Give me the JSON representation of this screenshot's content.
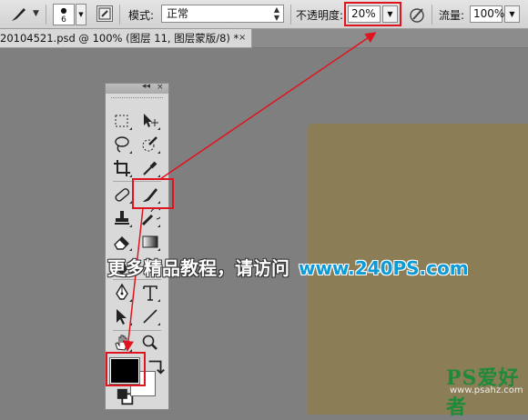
{
  "options_bar": {
    "brush_size": "6",
    "mode_label": "模式:",
    "mode_value": "正常",
    "opacity_label": "不透明度:",
    "opacity_value": "20%",
    "flow_label": "流量:",
    "flow_value": "100%"
  },
  "document_tab": {
    "title": "20104521.psd @ 100% (图层 11, 图层蒙版/8) *",
    "close": "×"
  },
  "tools_panel": {
    "collapse": "◂◂",
    "close": "×"
  },
  "colors": {
    "foreground": "#000000",
    "background": "#ffffff",
    "canvas": "#8b7d56",
    "highlight": "#e0141e"
  },
  "watermark": {
    "text": "更多精品教程，请访问",
    "url": "www.240PS.com"
  },
  "logo": {
    "name": "PS爱好者",
    "url": "www.psahz.com"
  }
}
